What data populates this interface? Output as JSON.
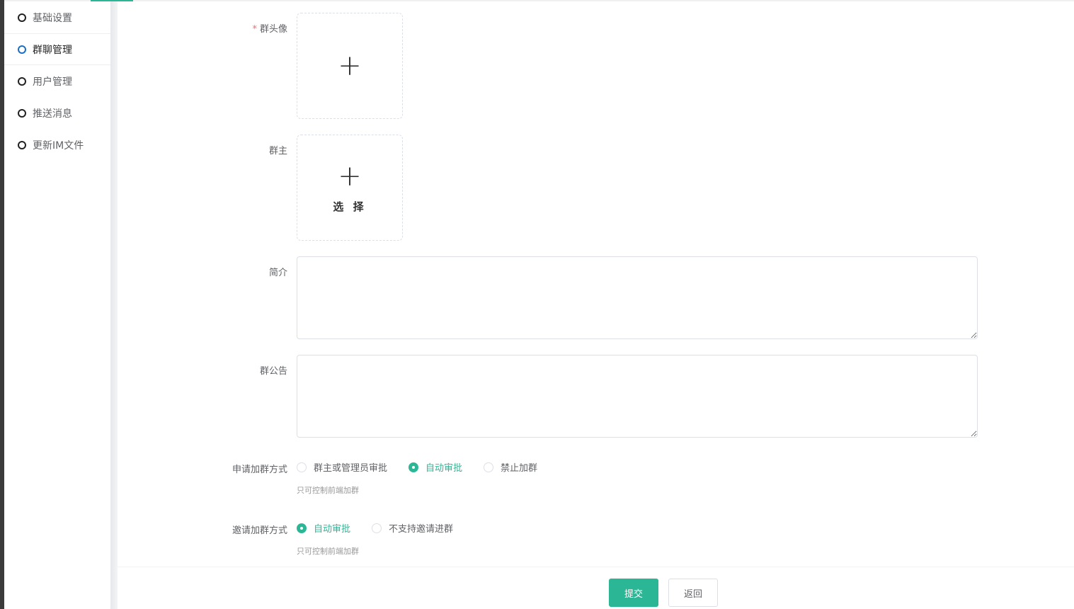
{
  "sidebar": {
    "items": [
      {
        "label": "基础设置"
      },
      {
        "label": "群聊管理"
      },
      {
        "label": "用户管理"
      },
      {
        "label": "推送消息"
      },
      {
        "label": "更新IM文件"
      }
    ]
  },
  "form": {
    "avatar_label": "群头像",
    "required_mark": "*",
    "owner_label": "群主",
    "owner_select": "选 择",
    "intro_label": "简介",
    "intro_value": "",
    "notice_label": "群公告",
    "notice_value": "",
    "apply_label": "申请加群方式",
    "apply_options": [
      {
        "label": "群主或管理员审批"
      },
      {
        "label": "自动审批"
      },
      {
        "label": "禁止加群"
      }
    ],
    "apply_selected": "自动审批",
    "apply_hint": "只可控制前端加群",
    "invite_label": "邀请加群方式",
    "invite_options": [
      {
        "label": "自动审批"
      },
      {
        "label": "不支持邀请进群"
      }
    ],
    "invite_selected": "自动审批",
    "invite_hint": "只可控制前端加群"
  },
  "footer": {
    "submit": "提交",
    "back": "返回"
  },
  "colors": {
    "accent": "#2bb795"
  }
}
